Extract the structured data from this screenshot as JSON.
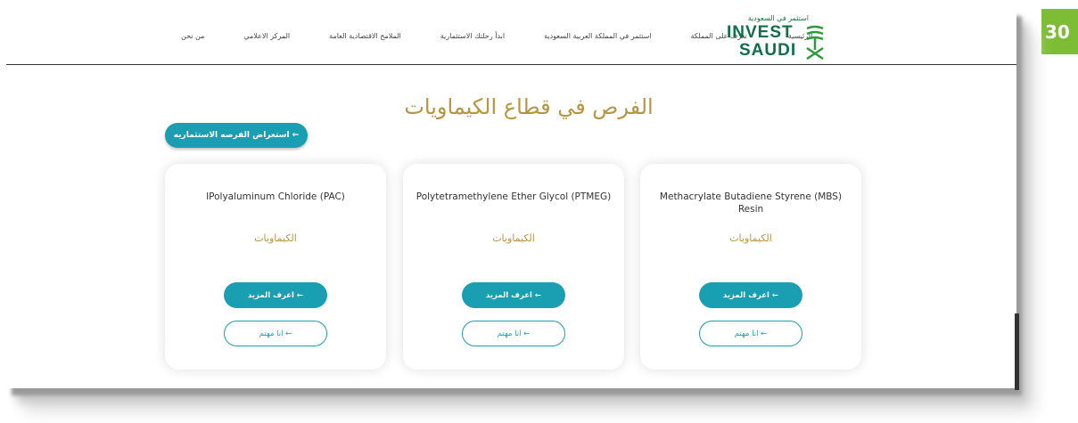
{
  "page_number": "30",
  "header": {
    "logo": {
      "arabic": "استثمر في السعودية",
      "line1": "INVEST",
      "line2": "SAUDI"
    },
    "nav": [
      "الرئيسية",
      "تعرّف على المملكة",
      "استثمر في المملكة العربية السعودية",
      "ابدأ رحلتك الاستثمارية",
      "الملامح الاقتصادية العامة",
      "المركز الاعلامي",
      "من نحن"
    ]
  },
  "page_title": "الفرص في قطاع الكيماويات",
  "browse_button": "استعراض الفرصه الاستثماريه ←",
  "cards": [
    {
      "name": "IPolyaluminum Chloride (PAC)",
      "category": "الكيماويات",
      "more_label": "اعرف المزيد ←",
      "interest_label": "انا مهتم ←"
    },
    {
      "name": "Polytetramethylene Ether Glycol (PTMEG)",
      "category": "الكيماويات",
      "more_label": "اعرف المزيد ←",
      "interest_label": "انا مهتم ←"
    },
    {
      "name": "Methacrylate Butadiene Styrene (MBS) Resin",
      "category": "الكيماويات",
      "more_label": "اعرف المزيد ←",
      "interest_label": "انا مهتم ←"
    }
  ],
  "colors": {
    "accent": "#1a9eb1",
    "gold": "#b99440",
    "logo_green": "#0e6f49",
    "badge": "#7dbd35"
  }
}
